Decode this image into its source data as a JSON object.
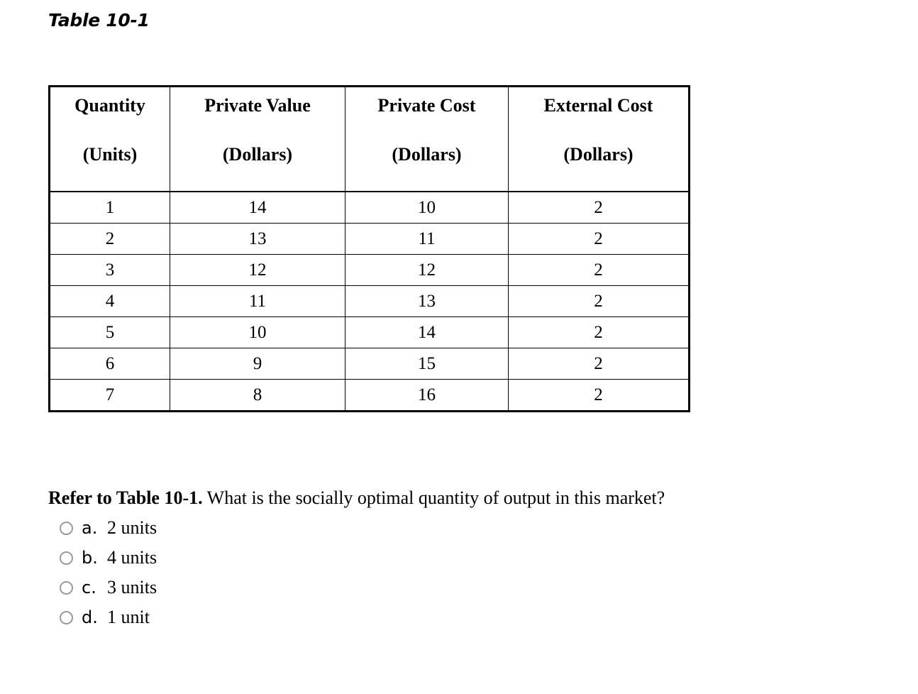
{
  "table": {
    "label": "Table 10-1",
    "columns": [
      {
        "main": "Quantity",
        "sub": "(Units)"
      },
      {
        "main": "Private Value",
        "sub": "(Dollars)"
      },
      {
        "main": "Private Cost",
        "sub": "(Dollars)"
      },
      {
        "main": "External Cost",
        "sub": "(Dollars)"
      }
    ],
    "rows": [
      {
        "quantity": "1",
        "private_value": "14",
        "private_cost": "10",
        "external_cost": "2"
      },
      {
        "quantity": "2",
        "private_value": "13",
        "private_cost": "11",
        "external_cost": "2"
      },
      {
        "quantity": "3",
        "private_value": "12",
        "private_cost": "12",
        "external_cost": "2"
      },
      {
        "quantity": "4",
        "private_value": "11",
        "private_cost": "13",
        "external_cost": "2"
      },
      {
        "quantity": "5",
        "private_value": "10",
        "private_cost": "14",
        "external_cost": "2"
      },
      {
        "quantity": "6",
        "private_value": "9",
        "private_cost": "15",
        "external_cost": "2"
      },
      {
        "quantity": "7",
        "private_value": "8",
        "private_cost": "16",
        "external_cost": "2"
      }
    ]
  },
  "question": {
    "prefix": "Refer to Table 10-1.",
    "text": " What is the socially optimal quantity of output in this market?",
    "options": [
      {
        "letter": "a.",
        "text": "2 units",
        "selected": false
      },
      {
        "letter": "b.",
        "text": "4 units",
        "selected": false
      },
      {
        "letter": "c.",
        "text": "3 units",
        "selected": false
      },
      {
        "letter": "d.",
        "text": "1 unit",
        "selected": false
      }
    ]
  },
  "colors": {
    "text": "#000000",
    "background": "#ffffff",
    "table_border": "#000000",
    "radio_border": "#9a9a9a"
  }
}
